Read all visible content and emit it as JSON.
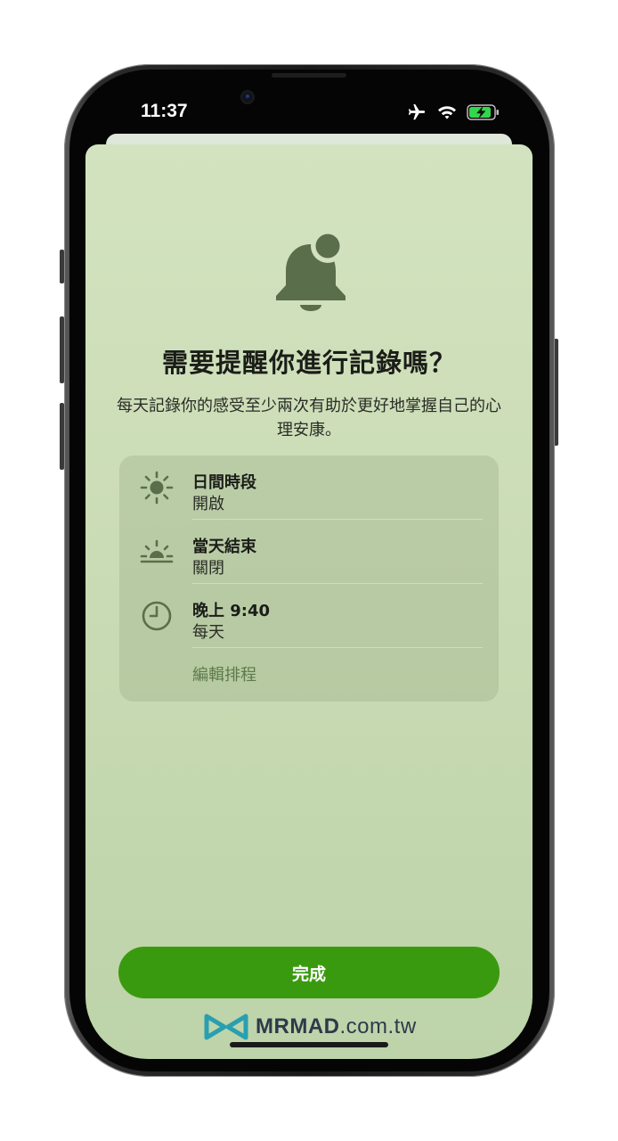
{
  "status_bar": {
    "time": "11:37",
    "icons": [
      "airplane-icon",
      "wifi-icon",
      "battery-charging-icon"
    ],
    "battery_color": "#32d74b"
  },
  "sheet": {
    "icon": "bell-badge-icon",
    "title": "需要提醒你進行記錄嗎？",
    "description": "每天記錄你的感受至少兩次有助於更好地掌握自己的心理安康。",
    "schedule": [
      {
        "icon": "sun-icon",
        "title": "日間時段",
        "status": "開啟"
      },
      {
        "icon": "sunset-icon",
        "title": "當天結束",
        "status": "關閉"
      },
      {
        "icon": "clock-icon",
        "title": "晚上 9:40",
        "status": "每天"
      }
    ],
    "edit_label": "編輯排程",
    "done_label": "完成"
  },
  "watermark": {
    "brand": "MRMAD",
    "domain": ".com.tw"
  },
  "colors": {
    "sheet_bg": "#cfe0bb",
    "accent_green": "#3a9a0f",
    "icon_green": "#5b6e4c",
    "link_green": "#5d7a4a"
  }
}
